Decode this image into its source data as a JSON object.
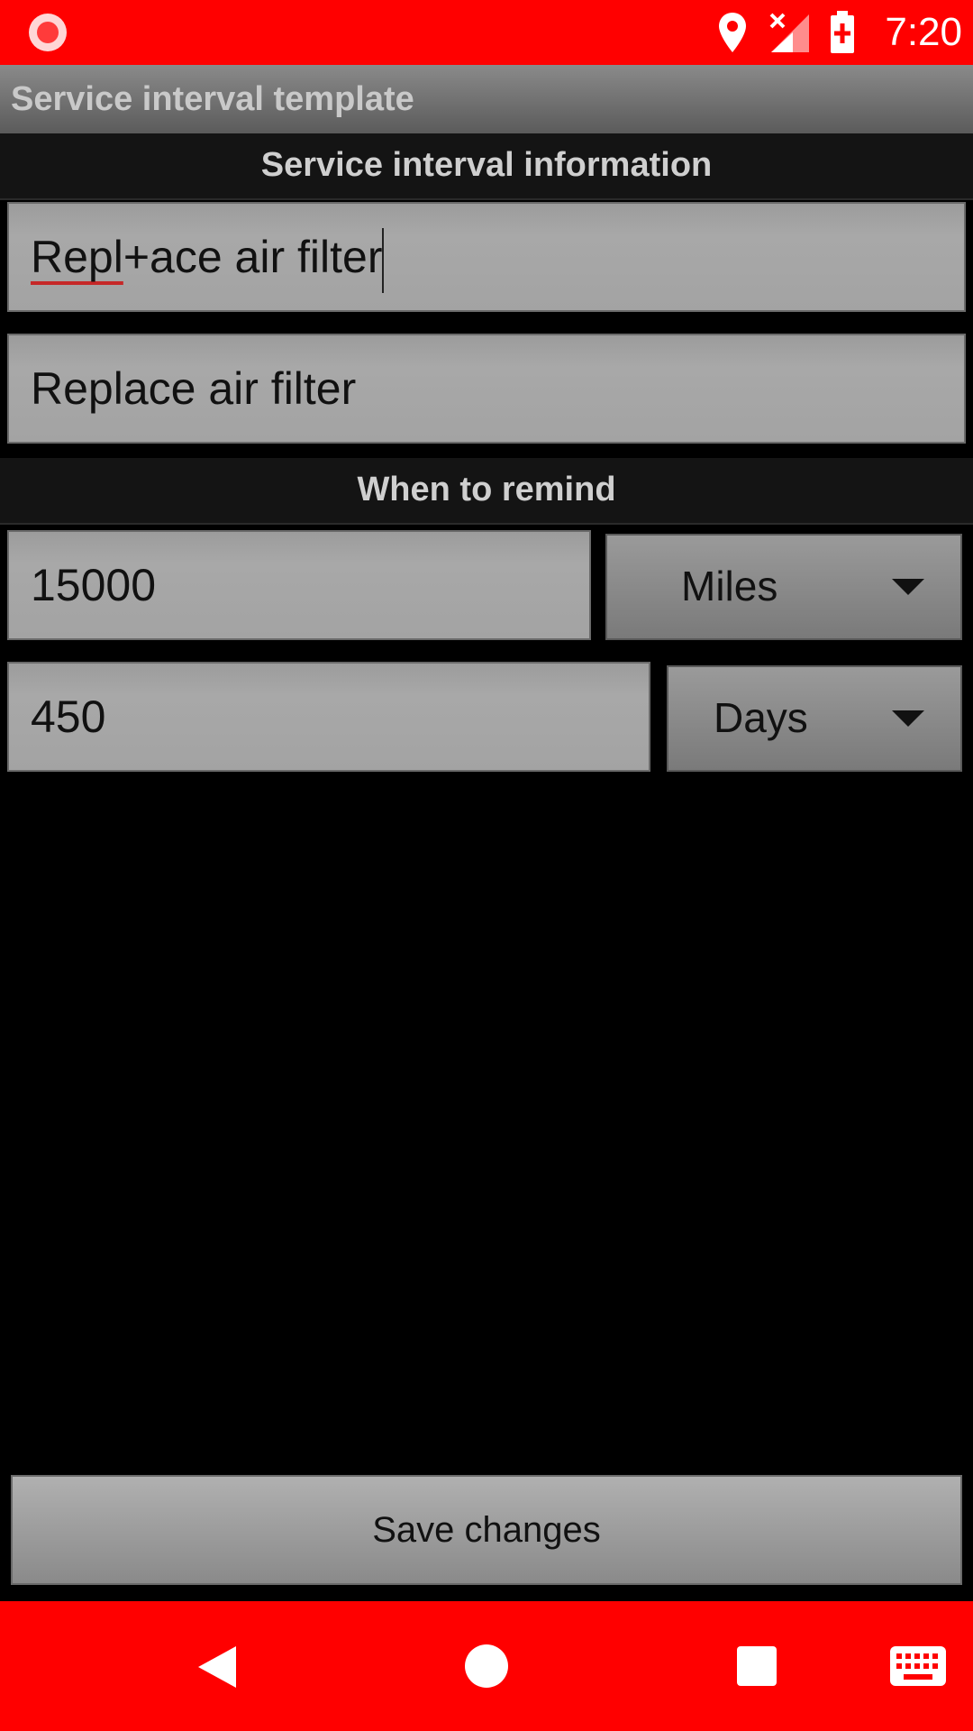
{
  "status_bar": {
    "time": "7:20",
    "icons": [
      "record-icon",
      "location-icon",
      "signal-no-service-icon",
      "battery-charging-icon"
    ]
  },
  "app": {
    "title": "Service interval template"
  },
  "sections": {
    "info_header": "Service interval information",
    "remind_header": "When to remind"
  },
  "fields": {
    "name_value_misspelled": "Repl",
    "name_value_rest": "+ace air filter",
    "description_value": "Replace air filter",
    "distance_value": "15000",
    "time_value": "450"
  },
  "spinners": {
    "distance_unit": "Miles",
    "time_unit": "Days"
  },
  "actions": {
    "save_label": "Save changes"
  },
  "nav_bar": {
    "icons": [
      "back-icon",
      "home-icon",
      "recents-icon",
      "keyboard-icon"
    ]
  },
  "colors": {
    "accent": "#ff0000",
    "background": "#000000",
    "field": "#a3a3a3"
  }
}
